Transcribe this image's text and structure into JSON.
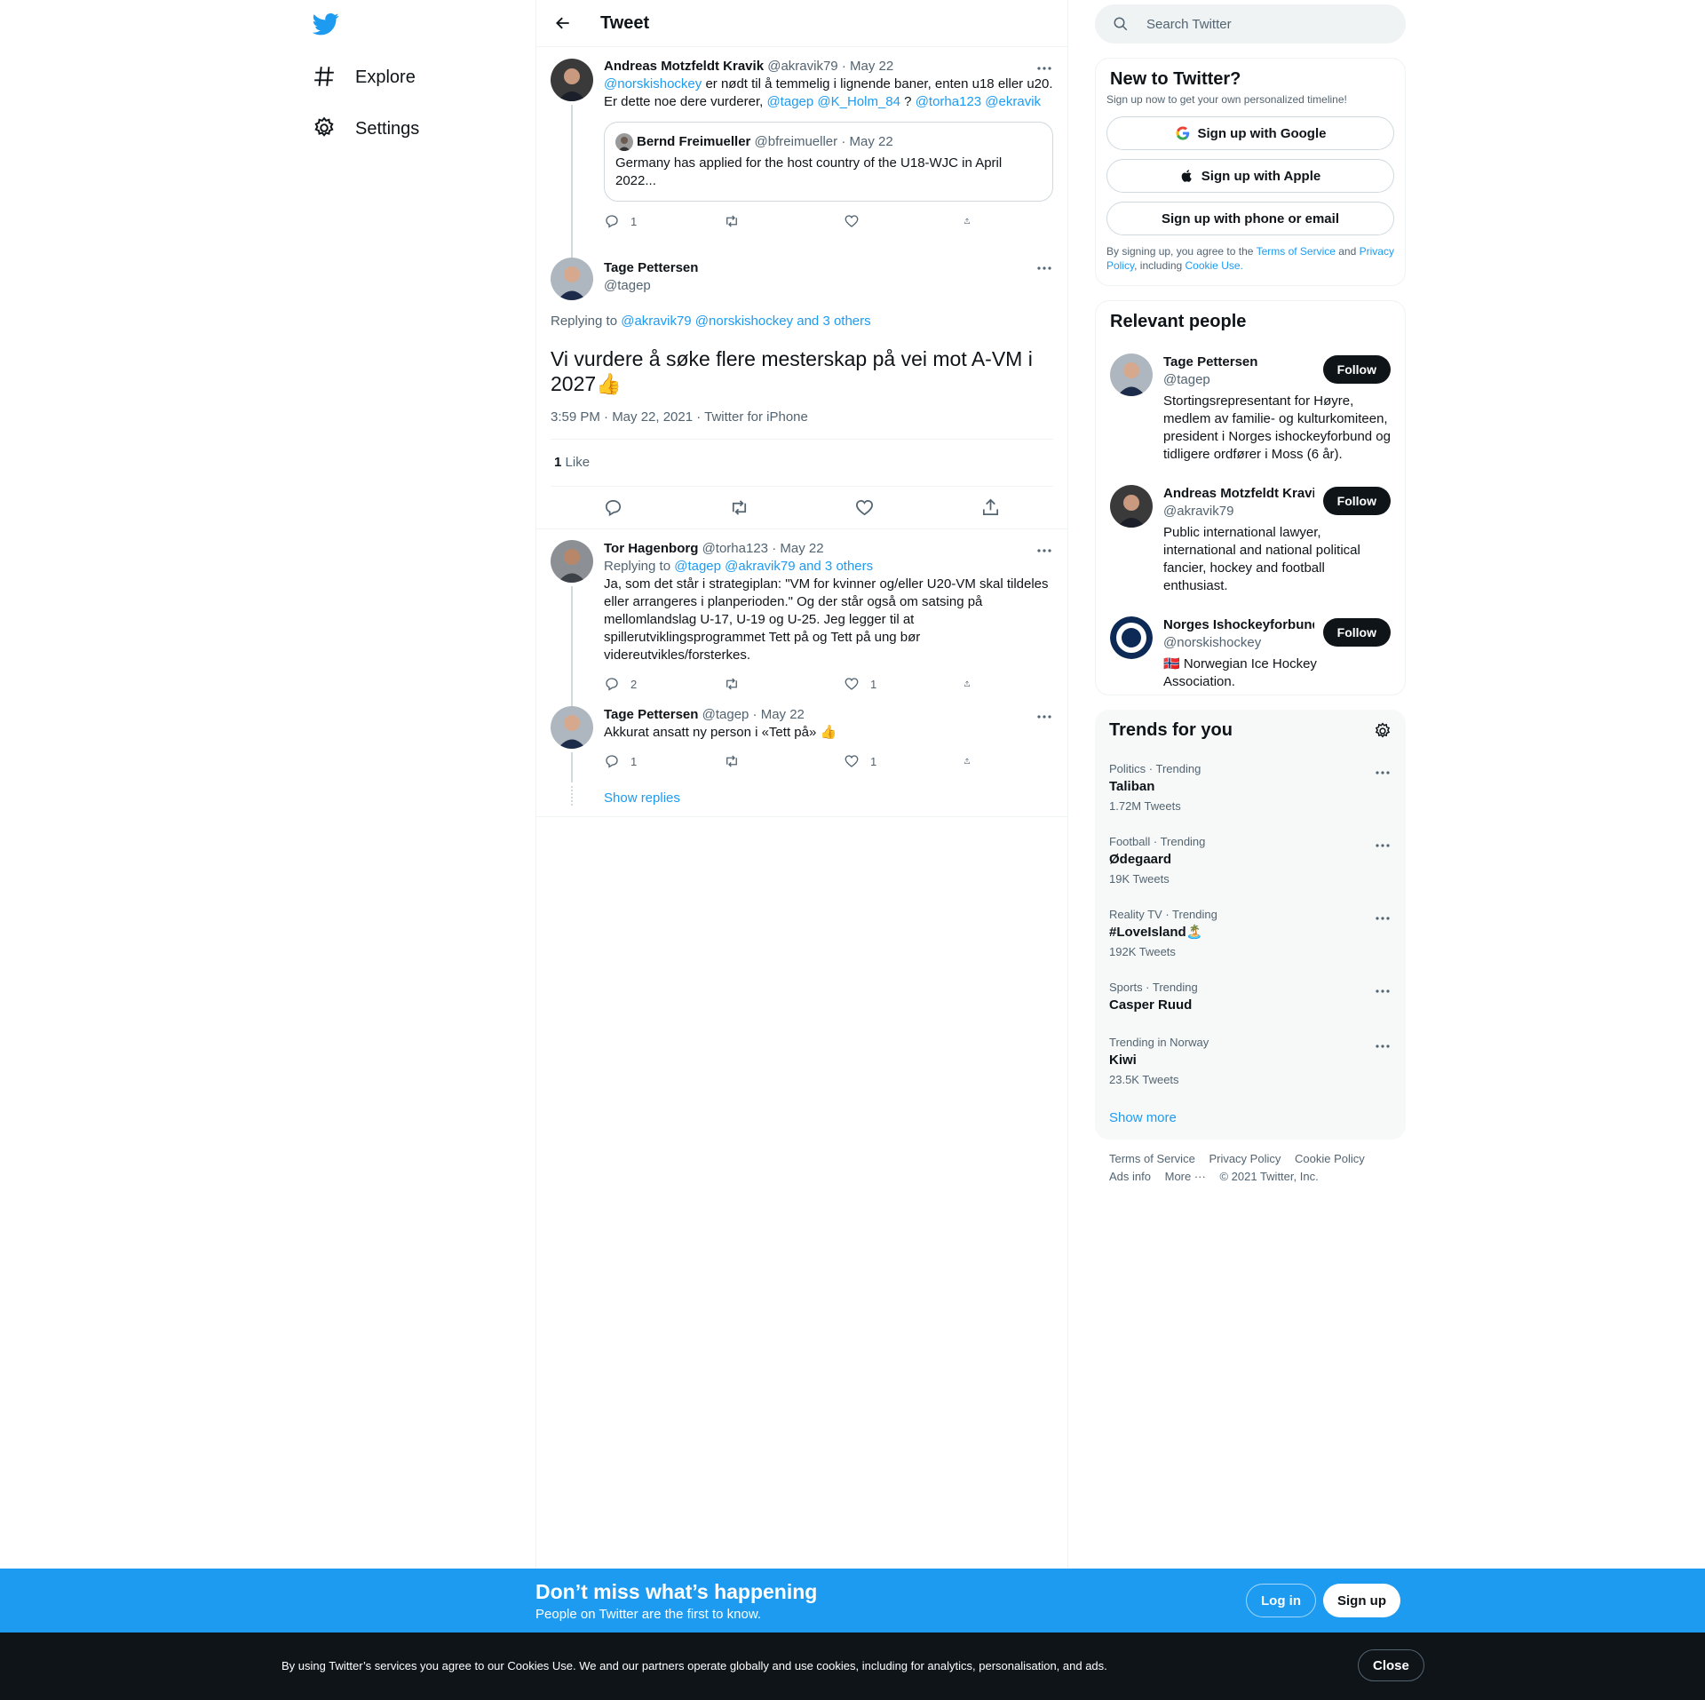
{
  "nav": {
    "items": [
      {
        "label": "Explore",
        "icon": "hashtag-icon"
      },
      {
        "label": "Settings",
        "icon": "gear-icon"
      }
    ]
  },
  "header": {
    "title": "Tweet"
  },
  "tweets": {
    "t1": {
      "name": "Andreas Motzfeldt Kravik",
      "handle": "@akravik79",
      "date": "· May 22",
      "mention1": "@norskishockey",
      "text1": " er nødt til å temmelig i lignende baner, enten u18 eller u20. Er dette noe dere vurderer, ",
      "mention2": "@tagep @K_Holm_84",
      "text2": " ? ",
      "mention3": "@torha123 @ekravik",
      "quote": {
        "name": "Bernd Freimueller",
        "handle": "@bfreimueller",
        "date": "· May 22",
        "text": "Germany has applied for the host country of the U18-WJC in April 2022..."
      },
      "replies": "1"
    },
    "main": {
      "name": "Tage Pettersen",
      "handle": "@tagep",
      "replying_prefix": "Replying to ",
      "replying_to": "@akravik79 @norskishockey and 3 others",
      "text": "Vi vurdere å søke flere mesterskap på vei mot A-VM i 2027👍",
      "meta": "3:59 PM · May 22, 2021 · Twitter for iPhone",
      "likes_count": "1",
      "likes_label": "Like"
    },
    "t3": {
      "name": "Tor Hagenborg",
      "handle": "@torha123",
      "date": "· May 22",
      "replying_prefix": "Replying to ",
      "replying_to": "@tagep @akravik79 and 3 others",
      "text": "Ja, som det står i strategiplan: \"VM for kvinner og/eller U20-VM skal tildeles eller arrangeres i planperioden.\" Og der står også om satsing på mellomlandslag U-17, U-19 og U-25. Jeg legger til at spillerutviklingsprogrammet Tett på og Tett på ung bør videreutvikles/forsterkes.",
      "replies": "2",
      "likes": "1"
    },
    "t4": {
      "name": "Tage Pettersen",
      "handle": "@tagep",
      "date": "· May 22",
      "text": "Akkurat ansatt ny person i «Tett på» 👍",
      "replies": "1",
      "likes": "1"
    },
    "show_replies": "Show replies"
  },
  "search": {
    "placeholder": "Search Twitter"
  },
  "signup_card": {
    "title": "New to Twitter?",
    "subtitle": "Sign up now to get your own personalized timeline!",
    "google": "Sign up with Google",
    "apple": "Sign up with Apple",
    "phone": "Sign up with phone or email",
    "legal_1": "By signing up, you agree to the ",
    "tos": "Terms of Service",
    "legal_2": " and ",
    "privacy": "Privacy Policy",
    "legal_3": ", including ",
    "cookie": "Cookie Use."
  },
  "relevant": {
    "title": "Relevant people",
    "follow_label": "Follow",
    "people": [
      {
        "name": "Tage Pettersen",
        "handle": "@tagep",
        "bio": "Stortingsrepresentant for Høyre, medlem av familie- og kulturkomiteen, president i Norges ishockeyforbund og tidligere ordfører i Moss (6 år)."
      },
      {
        "name": "Andreas Motzfeldt Kravik",
        "handle": "@akravik79",
        "bio": "Public international lawyer, international and national political fancier, hockey and football enthusiast."
      },
      {
        "name": "Norges Ishockeyforbund",
        "handle": "@norskishockey",
        "bio": "🇳🇴 Norwegian Ice Hockey Association."
      }
    ]
  },
  "trends": {
    "title": "Trends for you",
    "items": [
      {
        "meta": "Politics · Trending",
        "name": "Taliban",
        "count": "1.72M Tweets"
      },
      {
        "meta": "Football · Trending",
        "name": "Ødegaard",
        "count": "19K Tweets"
      },
      {
        "meta": "Reality TV · Trending",
        "name": "#LoveIsland🏝️",
        "count": "192K Tweets"
      },
      {
        "meta": "Sports · Trending",
        "name": "Casper Ruud",
        "count": ""
      },
      {
        "meta": "Trending in Norway",
        "name": "Kiwi",
        "count": "23.5K Tweets"
      }
    ],
    "show_more": "Show more"
  },
  "footer": {
    "terms": "Terms of Service",
    "privacy": "Privacy Policy",
    "cookie": "Cookie Policy",
    "ads": "Ads info",
    "more": "More ···",
    "copyright": "© 2021 Twitter, Inc."
  },
  "promo": {
    "title": "Don’t miss what’s happening",
    "subtitle": "People on Twitter are the first to know.",
    "login": "Log in",
    "signup": "Sign up"
  },
  "cookie_bar": {
    "text": "By using Twitter’s services you agree to our Cookies Use. We and our partners operate globally and use cookies, including for analytics, personalisation, and ads.",
    "close": "Close"
  },
  "colors": {
    "accent": "#1d9bf0",
    "text": "#0f1419",
    "secondary": "#536471"
  }
}
